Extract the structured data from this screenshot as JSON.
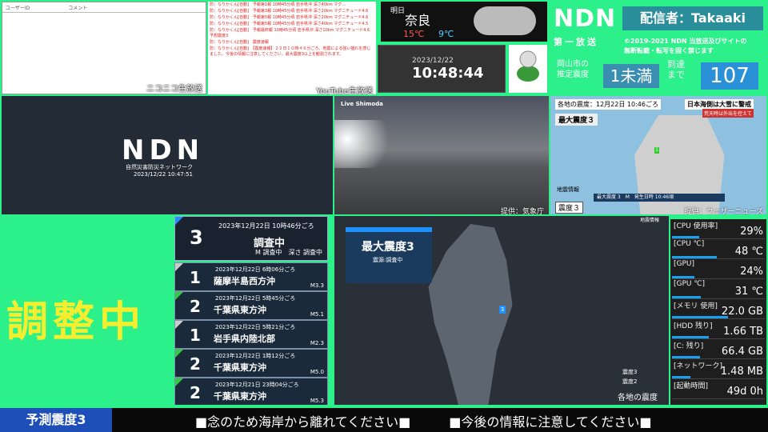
{
  "comments": {
    "col_user": "ユーザーID",
    "col_comment": "コメント",
    "label": "ニコニコ生放送"
  },
  "messages": {
    "items": [
      "防：なりかくん[自動]　予報第1報 10時45分頃 岩手県沖 深さ40km マグ...",
      "防：なりかくん[自動]　予報第3報 10時45分頃 岩手県沖 深さ20km マグニチュード4.6",
      "防：なりかくん[自動]　予報第5報 10時45分頃 岩手県沖 深さ20km マグニチュード4.6",
      "防：なりかくん[自動]　予報第5報 10時45分頃 岩手県沖 深さ40km マグニチュード4.5",
      "防：なりかくん[自動]　予報最終報 10時45分頃 岩手県沖 深さ10km マグニチュード4.6 予想震度3",
      "防：なりかくん[自動]　震度速報",
      "防：なりかくん[自動]　【震度速報】２２日１０時４６分ごろ、地震による強い揺れを感じました。今後の情報に注意してください。最大震度3以上を観測されます。"
    ],
    "label": "YouTube生放送"
  },
  "weather": {
    "day": "明日",
    "city": "奈良",
    "high": "15℃",
    "low": "9℃"
  },
  "clock": {
    "date": "2023/12/22",
    "time": "10:48:44"
  },
  "header": {
    "logo": "NDN",
    "deliverer": "配信者：Takaaki",
    "first_broadcast": "第一放送",
    "copyright_1": "©2019-2021 NDN 当放送及びサイトの",
    "copyright_2": "無断転載・転写を固く禁じます",
    "okayama_label_1": "岡山市の",
    "okayama_label_2": "推定震度",
    "intensity": "1未満",
    "arrival_label_1": "到達",
    "arrival_label_2": "まで",
    "arrival": "107"
  },
  "ndn_video": {
    "logo": "NDN",
    "subtitle": "自然災害防災ネットワーク",
    "timestamp": "2023/12/22 10:47:51"
  },
  "camera": {
    "logo": "Live Shimoda",
    "credit": "提供：気象庁"
  },
  "intensity_map": {
    "title": "各地の震度：12月22日 10:46ごろ",
    "warning": "日本海側は大雪に警戒",
    "warning_sub": "荒天時は外出を控えて",
    "max": "最大震度３",
    "bar": "最大震度 3　M　発生日時 10:46頃",
    "label": "地震情報",
    "box": "震度３",
    "point": "1",
    "credit": "提供：ウェザーニューズ"
  },
  "adjusting": "調整中",
  "quake_list": [
    {
      "time": "2023年12月22日 10時46分ごろ",
      "intensity": "3",
      "place": "調査中",
      "mag": "M 調査中　深さ 調査中",
      "color": "#1e90ff"
    },
    {
      "time": "2023年12月22日 6時06分ごろ",
      "intensity": "1",
      "place": "薩摩半島西方沖",
      "mag": "M3.3",
      "color": "#ccc"
    },
    {
      "time": "2023年12月22日 5時45分ごろ",
      "intensity": "2",
      "place": "千葉県東方沖",
      "mag": "M5.1",
      "color": "#2ecc40"
    },
    {
      "time": "2023年12月22日 5時21分ごろ",
      "intensity": "1",
      "place": "岩手県内陸北部",
      "mag": "M2.3",
      "color": "#ccc"
    },
    {
      "time": "2023年12月22日 1時12分ごろ",
      "intensity": "2",
      "place": "千葉県東方沖",
      "mag": "M5.0",
      "color": "#2ecc40"
    },
    {
      "time": "2023年12月21日 23時04分ごろ",
      "intensity": "2",
      "place": "千葉県東方沖",
      "mag": "M5.3",
      "color": "#2ecc40"
    }
  ],
  "map": {
    "card_title": "最大震度3",
    "card_sub": "震源:調査中",
    "point": "3",
    "legend_1": "震度3",
    "legend_2": "震度2",
    "label": "各地の震度",
    "credit": "地震情報"
  },
  "stats": [
    {
      "key": "[CPU 使用率]",
      "value": "29%",
      "pct": 29
    },
    {
      "key": "[CPU ℃]",
      "value": "48 ℃",
      "pct": 48
    },
    {
      "key": "[GPU]",
      "value": "24%",
      "pct": 24
    },
    {
      "key": "[GPU ℃]",
      "value": "31 ℃",
      "pct": 31
    },
    {
      "key": "[メモリ 使用]",
      "value": "22.0 GB",
      "pct": 60
    },
    {
      "key": "[HDD 残り]",
      "value": "1.66 TB",
      "pct": 40
    },
    {
      "key": "[C: 残り]",
      "value": "66.4 GB",
      "pct": 30
    },
    {
      "key": "[ネットワーク]",
      "value": "1.48 MB",
      "pct": 20
    },
    {
      "key": "[起動時間]",
      "value": "49d 0h",
      "pct": 0
    }
  ],
  "bottom": {
    "label": "予測震度3",
    "ticker": "■念のため海岸から離れてください■　　　■今後の情報に注意してください■"
  }
}
